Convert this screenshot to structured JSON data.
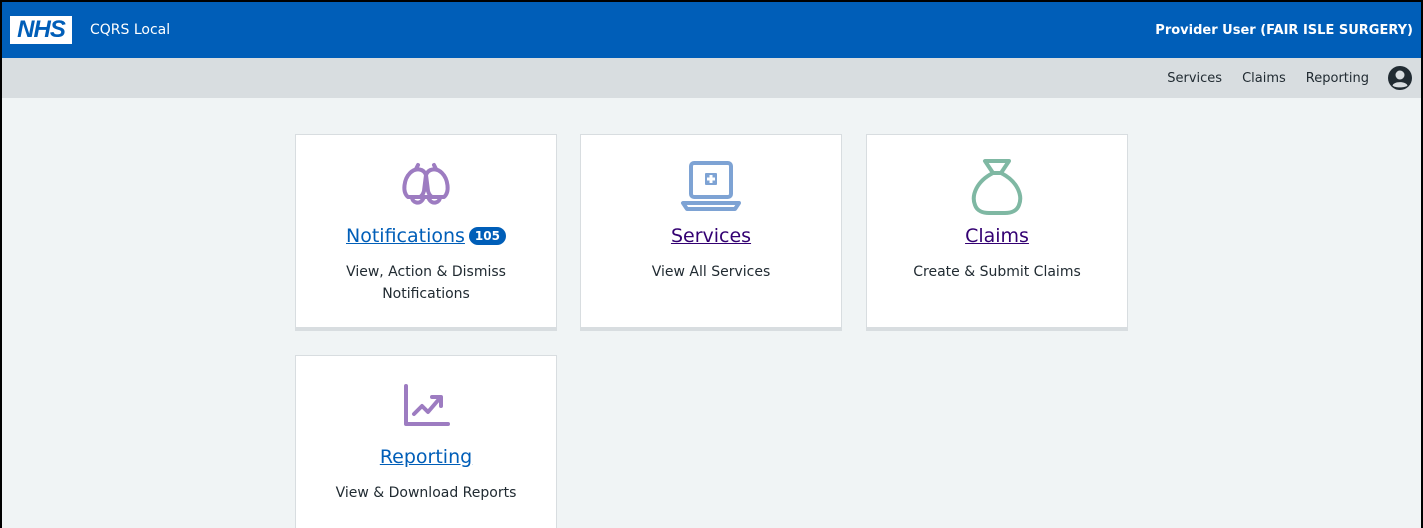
{
  "header": {
    "logo_text": "NHS",
    "app_name": "CQRS Local",
    "user_label": "Provider User (FAIR ISLE SURGERY)"
  },
  "nav": {
    "items": [
      "Services",
      "Claims",
      "Reporting"
    ],
    "account_icon": "account-circle-icon"
  },
  "tiles": [
    {
      "title": "Notifications",
      "badge": "105",
      "description": "View, Action & Dismiss Notifications",
      "icon": "bells-icon",
      "color": "#9d7cc1"
    },
    {
      "title": "Services",
      "description": "View All Services",
      "icon": "laptop-plus-icon",
      "color": "#7ea3d4"
    },
    {
      "title": "Claims",
      "description": "Create & Submit Claims",
      "icon": "money-bag-icon",
      "color": "#7fb8a3"
    },
    {
      "title": "Reporting",
      "description": "View & Download Reports",
      "icon": "trend-chart-icon",
      "color": "#9d7cc1"
    }
  ],
  "colors": {
    "brand": "#005eb8",
    "visited_link": "#330072"
  }
}
